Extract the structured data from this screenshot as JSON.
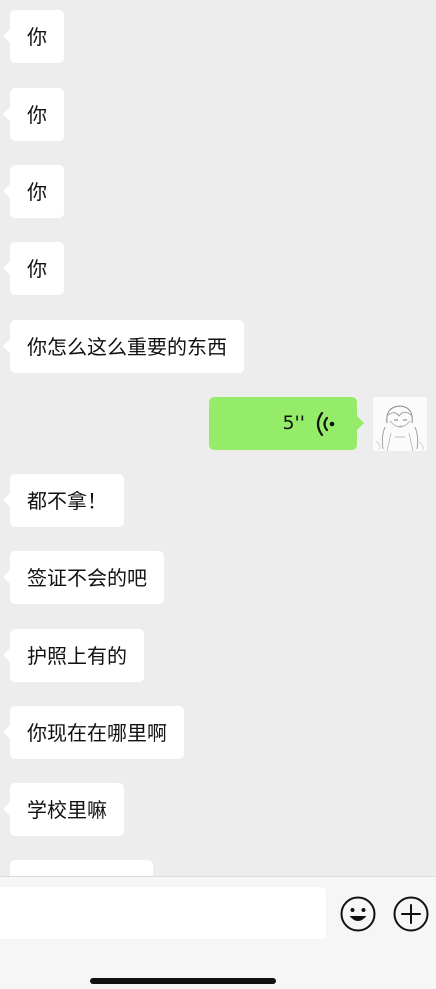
{
  "messages": [
    {
      "text": "你",
      "direction": "incoming"
    },
    {
      "text": "你",
      "direction": "incoming"
    },
    {
      "text": "你",
      "direction": "incoming"
    },
    {
      "text": "你",
      "direction": "incoming"
    },
    {
      "text": "你怎么这么重要的东西",
      "direction": "incoming"
    },
    {
      "voice_duration": "5''",
      "direction": "outgoing",
      "type": "voice"
    },
    {
      "text": "都不拿！",
      "direction": "incoming"
    },
    {
      "text": "签证不会的吧",
      "direction": "incoming"
    },
    {
      "text": "护照上有的",
      "direction": "incoming"
    },
    {
      "text": "你现在在哪里啊",
      "direction": "incoming"
    },
    {
      "text": "学校里嘛",
      "direction": "incoming"
    },
    {
      "text": "",
      "direction": "incoming"
    }
  ],
  "input_bar": {
    "placeholder": "",
    "icons": [
      "emoji-icon",
      "plus-icon"
    ]
  },
  "colors": {
    "background": "#ededed",
    "incoming_bubble": "#ffffff",
    "outgoing_bubble": "#95ec69"
  }
}
